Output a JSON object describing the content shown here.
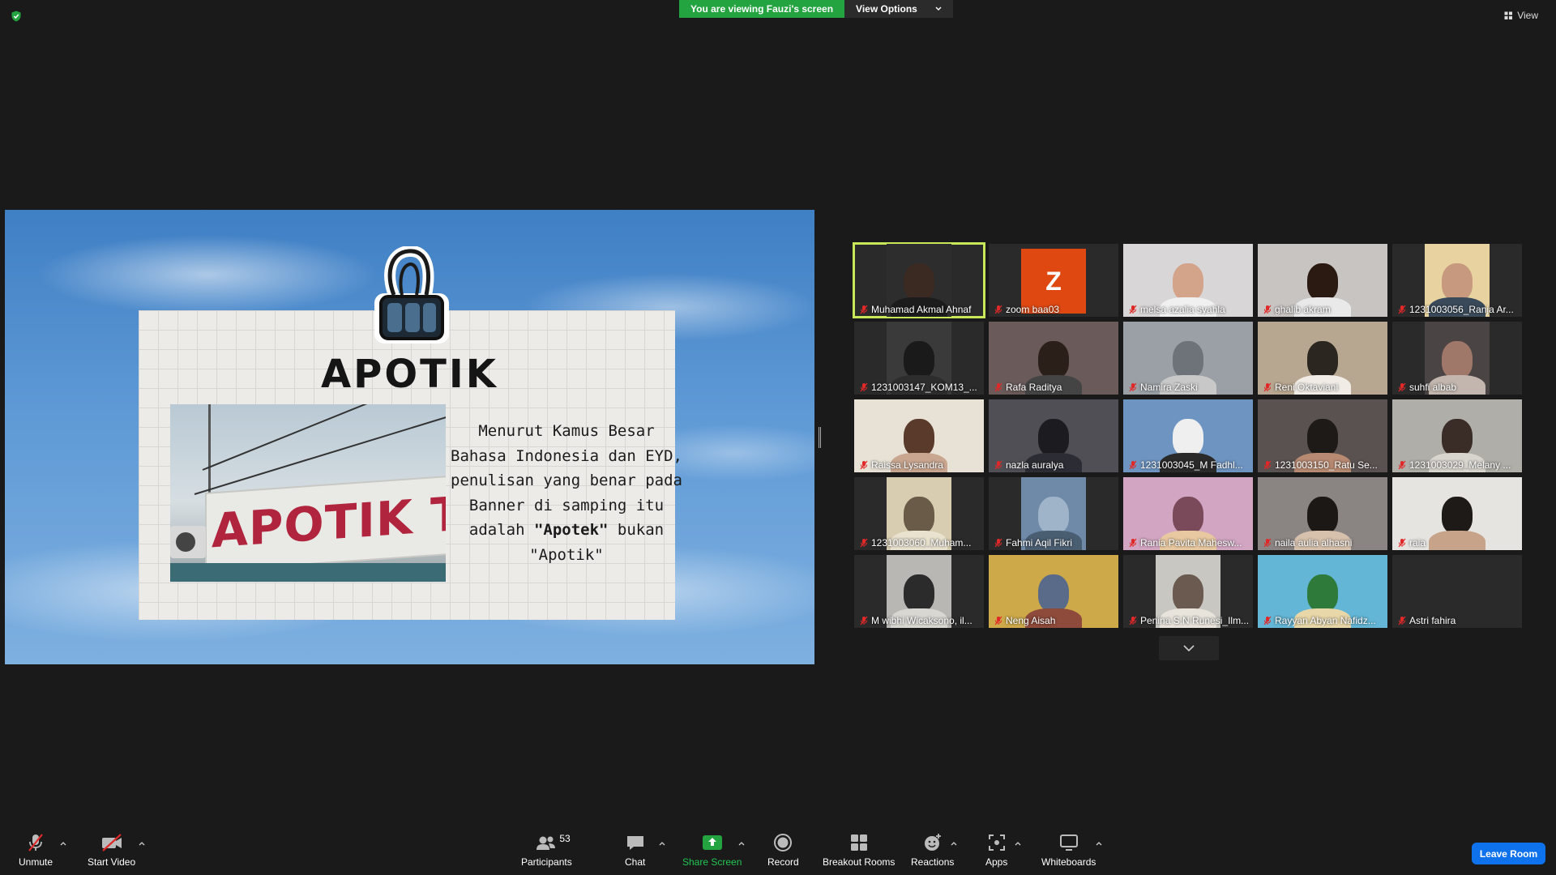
{
  "top": {
    "viewing_banner": "You are viewing Fauzi's screen",
    "view_options": "View Options",
    "view_button": "View"
  },
  "slide": {
    "title": "APOTIK",
    "sign_text": "APOTIK TAN",
    "text_before": "Menurut Kamus Besar Bahasa Indonesia dan EYD, penulisan yang benar pada Banner di samping itu adalah ",
    "word_correct": "\"Apotek\"",
    "text_middle": " bukan ",
    "word_wrong": "\"Apotik\""
  },
  "participants": [
    {
      "name": "Muhamad Akmal Ahnaf",
      "active": true
    },
    {
      "name": "zoom baa03",
      "avatar_letter": "Z"
    },
    {
      "name": "melsa azalia syahla"
    },
    {
      "name": "ghalib akram"
    },
    {
      "name": "1231003056_Ranja Ar..."
    },
    {
      "name": "1231003147_KOM13_..."
    },
    {
      "name": "Rafa Raditya"
    },
    {
      "name": "Namira Zaski"
    },
    {
      "name": "Reni Oktaviani"
    },
    {
      "name": "suhfi albab"
    },
    {
      "name": "Raissa Lysandra"
    },
    {
      "name": "nazla auralya"
    },
    {
      "name": "1231003045_M Fadhl..."
    },
    {
      "name": "1231003150_Ratu Se..."
    },
    {
      "name": "1231003029_Melany ..."
    },
    {
      "name": "1231003060_Muham..."
    },
    {
      "name": "Fahmi Aqil Fikri"
    },
    {
      "name": "Rania Pavita Mahesw..."
    },
    {
      "name": "naila aulia alhasni"
    },
    {
      "name": "raia"
    },
    {
      "name": "M wibhi Wicaksono, il..."
    },
    {
      "name": "Neng Aisah"
    },
    {
      "name": "Penina S.N Runesi_Ilm..."
    },
    {
      "name": "Rayyan Abyan Nafidz..."
    },
    {
      "name": "Astri fahira"
    }
  ],
  "toolbar": {
    "unmute": "Unmute",
    "start_video": "Start Video",
    "participants": "Participants",
    "participants_count": "53",
    "chat": "Chat",
    "share_screen": "Share Screen",
    "record": "Record",
    "breakout_rooms": "Breakout Rooms",
    "reactions": "Reactions",
    "apps": "Apps",
    "whiteboards": "Whiteboards",
    "leave": "Leave Room"
  },
  "colors": {
    "share_green": "#23a440",
    "active_border": "#c8e85a",
    "leave_blue": "#0e72ed",
    "muted_red": "#e02828"
  }
}
